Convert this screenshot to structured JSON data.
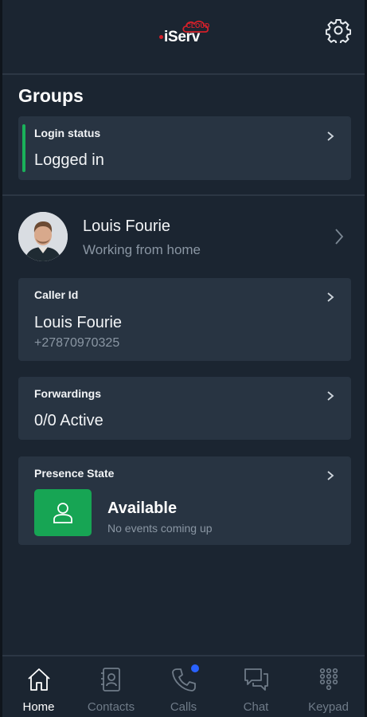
{
  "header": {
    "logo_text": "iServ",
    "logo_badge": "CLOUD"
  },
  "groups": {
    "title": "Groups",
    "login_status": {
      "label": "Login status",
      "value": "Logged in",
      "indicator_color": "#1ab15a"
    }
  },
  "profile": {
    "name": "Louis Fourie",
    "status": "Working from home"
  },
  "caller_id": {
    "label": "Caller Id",
    "name": "Louis Fourie",
    "number": "+27870970325"
  },
  "forwardings": {
    "label": "Forwardings",
    "value": "0/0 Active"
  },
  "presence": {
    "label": "Presence State",
    "state": "Available",
    "subtitle": "No events coming up",
    "color": "#17a554"
  },
  "nav": {
    "items": [
      {
        "label": "Home",
        "icon": "home-icon",
        "active": true
      },
      {
        "label": "Contacts",
        "icon": "contacts-icon",
        "active": false
      },
      {
        "label": "Calls",
        "icon": "phone-icon",
        "active": false,
        "badge": true
      },
      {
        "label": "Chat",
        "icon": "chat-icon",
        "active": false
      },
      {
        "label": "Keypad",
        "icon": "keypad-icon",
        "active": false
      }
    ],
    "badge_color": "#2962ff"
  }
}
